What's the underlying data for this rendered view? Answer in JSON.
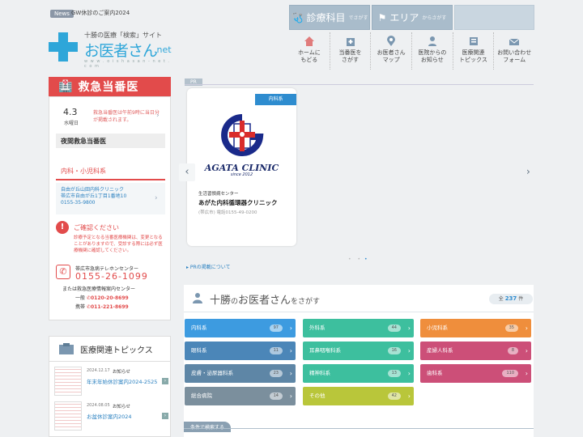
{
  "news": {
    "tag": "News",
    "text": "GW休診のご案内2024"
  },
  "logo": {
    "sub": "十勝の医療「検索」サイト",
    "main": "お医者さん",
    "net": ".net",
    "url": "w w w . o i s h a s a n - n e t . c o m"
  },
  "top_buttons": {
    "dept_label": "診療科目",
    "dept_small": "でさがす",
    "area_label": "エリア",
    "area_small": "からさがす"
  },
  "nav": [
    {
      "label": "ホームに\nもどる",
      "icon": "house-icon"
    },
    {
      "label": "当番医を\nさがす",
      "icon": "hospital-icon"
    },
    {
      "label": "お医者さん\nマップ",
      "icon": "map-pin-icon"
    },
    {
      "label": "医院からの\nお知らせ",
      "icon": "doctor-icon"
    },
    {
      "label": "医療関連\nトピックス",
      "icon": "news-icon"
    },
    {
      "label": "お問い合わせ\nフォーム",
      "icon": "mail-icon"
    }
  ],
  "emergency": {
    "title": "救急当番医",
    "date": "4.3",
    "day": "水曜日",
    "message": "救急当番医は午前9時に当日分が掲載されます。",
    "night_title": "夜間救急当番医",
    "ped_title": "内科・小児科系",
    "ped_clinic": "自由が丘山田内科クリニック",
    "ped_address": "帯広市自由が丘1丁目1番地10",
    "ped_tel": "0155-35-9800",
    "warn_title": "ご確認ください",
    "warn_text": "診療予定となる当番医療機関は、変更となることがありますので、受診する際には必ず医療機関に確認してください。",
    "tel_name": "帯広市急病テレホンセンター",
    "tel_num": "0155-26-1099",
    "tel_sub": "または救急医療情報案内センター",
    "ippan_label": "一般",
    "ippan_num": "0120-20-8699",
    "keitai_label": "携帯",
    "keitai_num": "011-221-8699"
  },
  "topics": {
    "title": "医療関連トピックス",
    "items": [
      {
        "date": "2024.12.17",
        "cat": "お知らせ",
        "title": "年末年始休診案内2024-2525"
      },
      {
        "date": "2024.08.05",
        "cat": "お知らせ",
        "title": "お盆休診案内2024"
      }
    ]
  },
  "pr": {
    "tag": "PR",
    "category": "内科系",
    "logo_text": "AGATA CLINIC",
    "logo_since": "since 2012",
    "sub": "生活習慣病センター",
    "name": "あがた内科循環器クリニック",
    "tel": "(帯広市) 電話0155-49-0200",
    "link": "PRの掲載について"
  },
  "search": {
    "title_pre": "十勝",
    "title_no": "の",
    "title_mid": "お医者さん",
    "title_wo": "をさがす",
    "count_pre": "全",
    "count": "237",
    "count_post": "件",
    "condition_tab": "条件で検索する",
    "departments": [
      {
        "name": "内科系",
        "count": "97",
        "color": "#3d9be0"
      },
      {
        "name": "外科系",
        "count": "44",
        "color": "#3dbf9e"
      },
      {
        "name": "小児科系",
        "count": "35",
        "color": "#ef8e3c"
      },
      {
        "name": "眼科系",
        "count": "11",
        "color": "#4b86b8"
      },
      {
        "name": "耳鼻咽喉科系",
        "count": "16",
        "color": "#3dbf9e"
      },
      {
        "name": "産婦人科系",
        "count": "8",
        "color": "#cc4f78"
      },
      {
        "name": "皮膚・泌尿器科系",
        "count": "23",
        "color": "#5e86a6"
      },
      {
        "name": "精神科系",
        "count": "13",
        "color": "#3dbf9e"
      },
      {
        "name": "歯科系",
        "count": "110",
        "color": "#cc4f78"
      },
      {
        "name": "総合病院",
        "count": "14",
        "color": "#7b8f9d"
      },
      {
        "name": "その他",
        "count": "42",
        "color": "#b9c63a"
      }
    ]
  }
}
